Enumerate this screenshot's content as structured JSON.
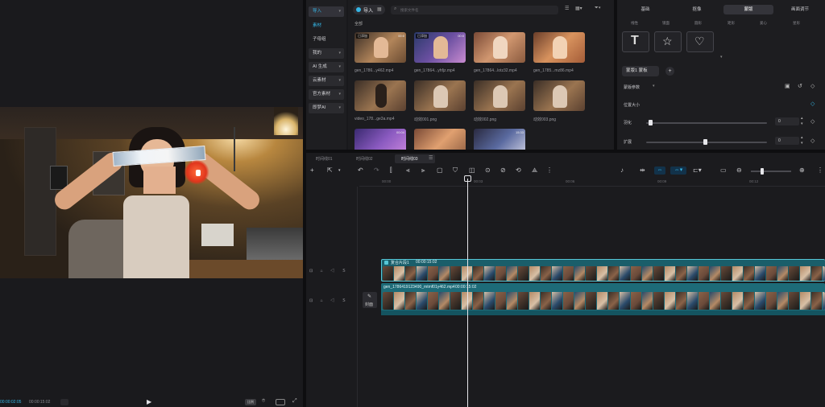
{
  "player": {
    "current_time": "00:00:02:05",
    "total_time": "00:00:15:02",
    "play_icon": "play-icon",
    "ratio_label": "比例",
    "controls": [
      "fullscreen-icon",
      "screenshot-icon",
      "ratio-icon"
    ]
  },
  "media_sidebar": {
    "items": [
      {
        "label": "导入",
        "active": true
      },
      {
        "label": "素材",
        "active": false
      },
      {
        "label": "子母组",
        "active": false
      },
      {
        "label": "我的",
        "dropdown": true
      },
      {
        "label": "AI 生成",
        "dropdown": true
      },
      {
        "label": "云素材",
        "dropdown": true
      },
      {
        "label": "官方素材",
        "dropdown": true
      },
      {
        "label": "即梦AI",
        "dropdown": true
      }
    ]
  },
  "media": {
    "import_label": "导入",
    "search_placeholder": "搜索文件名",
    "section_label": "全部",
    "items": [
      {
        "label": "gen_1786...y462.mp4",
        "badge": "已添加",
        "duration": "00:0"
      },
      {
        "label": "gen_17864...yhfjz.mp4",
        "badge": "已添加",
        "duration": "00:0"
      },
      {
        "label": "gen_17864...lotz32.mp4",
        "badge": "",
        "duration": ""
      },
      {
        "label": "gen_1785...mz86.mp4",
        "badge": "",
        "duration": ""
      },
      {
        "label": "video_178...ge3a.mp4",
        "badge": "",
        "duration": ""
      },
      {
        "label": "动效001.png",
        "badge": "",
        "duration": ""
      },
      {
        "label": "动效002.png",
        "badge": "",
        "duration": ""
      },
      {
        "label": "动效003.png",
        "badge": "",
        "duration": ""
      },
      {
        "label": "",
        "badge": "",
        "duration": "00:04"
      },
      {
        "label": "",
        "badge": "",
        "duration": ""
      },
      {
        "label": "",
        "badge": "",
        "duration": "15:33"
      }
    ]
  },
  "props": {
    "tabs": [
      "基础",
      "抠像",
      "蒙版",
      "画面调节"
    ],
    "active_tab": "蒙版",
    "subtabs": [
      "线性",
      "镜面",
      "圆形",
      "矩形",
      "爱心",
      "星形"
    ],
    "mask_chip": "蒙版1 蒙板",
    "add_label": "+",
    "mask_params_label": "蒙版参数",
    "position_size_label": "位置大小",
    "feather_label": "羽化",
    "feather_value": "0",
    "expand_label": "扩展",
    "expand_value": "0",
    "feather_level": 0.02,
    "expand_level": 0.47
  },
  "timeline": {
    "tabs": [
      "时间线01",
      "时间线02",
      "时间线03"
    ],
    "active_tab": "时间线03",
    "ruler": [
      "00:00",
      "00:03",
      "00:06",
      "00:09",
      "00:12"
    ],
    "track1_clip": {
      "name": "复合片段1",
      "duration": "00:00:15:02"
    },
    "track2_clip": {
      "name": "gen_1786419123490_mtmf01y462.mp4",
      "duration": "00:00:15:02"
    },
    "cover_label": "封面",
    "colors": {
      "clip_border": "#56c6d6",
      "clip_bg": "#1d6b78",
      "playhead": "#e6e6ea"
    }
  }
}
